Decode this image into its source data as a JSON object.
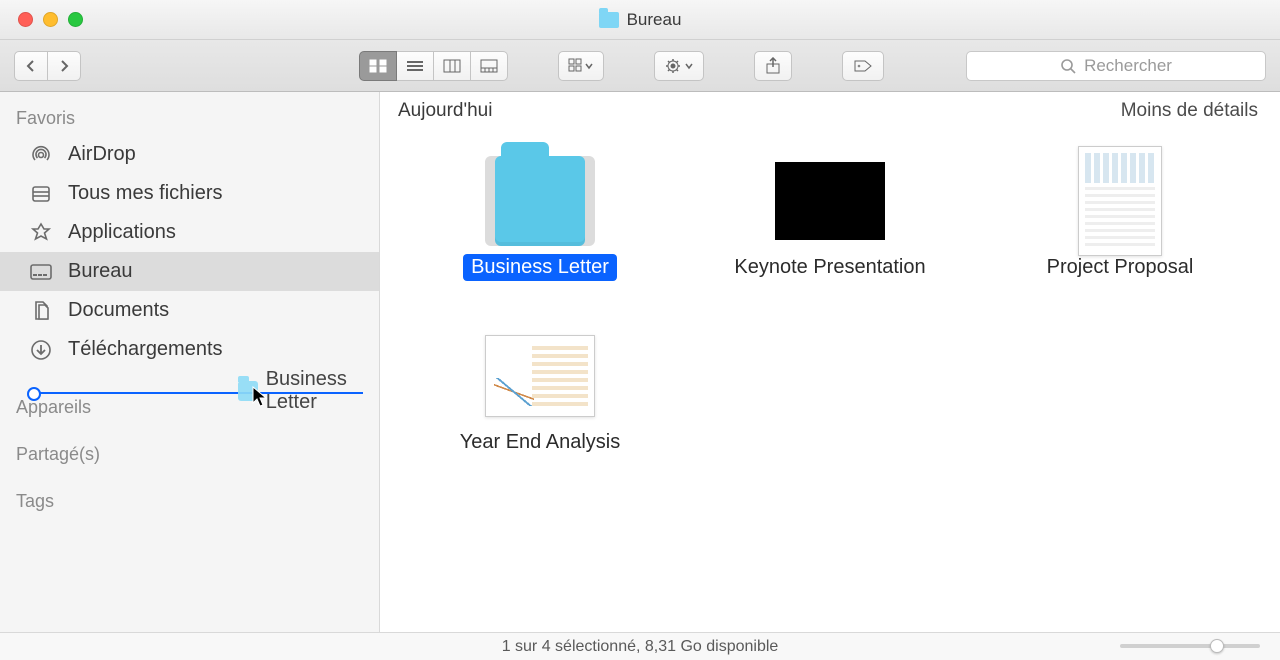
{
  "window": {
    "title": "Bureau"
  },
  "search": {
    "placeholder": "Rechercher"
  },
  "content": {
    "section_header": "Aujourd'hui",
    "detail_toggle": "Moins de détails",
    "items": [
      {
        "name": "Business Letter"
      },
      {
        "name": "Keynote Presentation"
      },
      {
        "name": "Project Proposal"
      },
      {
        "name": "Year End Analysis"
      }
    ]
  },
  "sidebar": {
    "favorites": {
      "header": "Favoris",
      "items": [
        {
          "label": "AirDrop"
        },
        {
          "label": "Tous mes fichiers"
        },
        {
          "label": "Applications"
        },
        {
          "label": "Bureau"
        },
        {
          "label": "Documents"
        },
        {
          "label": "Téléchargements"
        }
      ]
    },
    "devices_header": "Appareils",
    "shared_header": "Partagé(s)",
    "tags_header": "Tags"
  },
  "drag": {
    "ghost_label": "Business Letter"
  },
  "status": {
    "text": "1 sur 4 sélectionné, 8,31 Go disponible"
  }
}
